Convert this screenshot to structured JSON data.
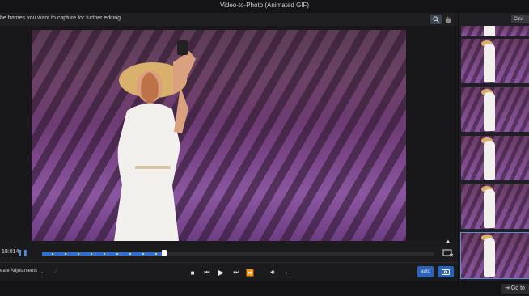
{
  "window": {
    "title": "Video-to-Photo (Animated GIF)"
  },
  "instructions": "he frames you want to capture for further editing.",
  "side_panel": {
    "clear_label": "Clea"
  },
  "timeline": {
    "timecode": "18:014"
  },
  "controls": {
    "adjust_label": "eate Adjustments",
    "auto_label": "auto"
  },
  "footer": {
    "goto_label": "Go to"
  },
  "icons": [
    "zoom-icon",
    "hand-icon",
    "pause-icon",
    "stop-icon",
    "prev-frame-icon",
    "play-icon",
    "next-frame-icon",
    "fast-forward-icon",
    "volume-icon",
    "speed-icon",
    "camera-icon",
    "crop-icon",
    "dropdown-icon"
  ],
  "colors": {
    "accent": "#2a63b8",
    "progress": "#2f6fcf",
    "marker": "#e8d04b"
  }
}
